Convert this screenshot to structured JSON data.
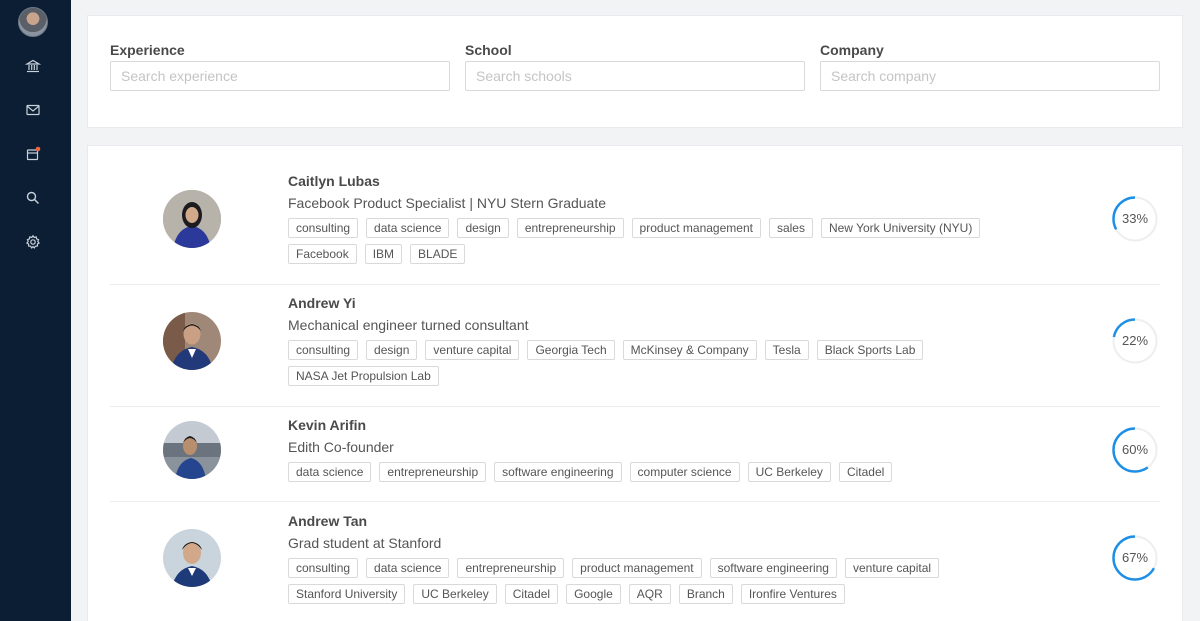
{
  "colors": {
    "sidebar": "#0b1e33",
    "accent": "#1f8fe6",
    "notification_dot": "#f0663f"
  },
  "sidebar": {
    "items": [
      {
        "icon": "bank-icon"
      },
      {
        "icon": "mail-icon"
      },
      {
        "icon": "calendar-icon"
      },
      {
        "icon": "search-icon"
      },
      {
        "icon": "gear-icon"
      }
    ]
  },
  "search": {
    "experience": {
      "label": "Experience",
      "placeholder": "Search experience"
    },
    "school": {
      "label": "School",
      "placeholder": "Search schools"
    },
    "company": {
      "label": "Company",
      "placeholder": "Search company"
    }
  },
  "profiles": [
    {
      "name": "Caitlyn Lubas",
      "headline": "Facebook Product Specialist | NYU Stern Graduate",
      "tags": [
        "consulting",
        "data science",
        "design",
        "entrepreneurship",
        "product management",
        "sales",
        "New York University (NYU)",
        "Facebook",
        "IBM",
        "BLADE"
      ],
      "match_label": "33%",
      "match": 0.33
    },
    {
      "name": "Andrew Yi",
      "headline": "Mechanical engineer turned consultant",
      "tags": [
        "consulting",
        "design",
        "venture capital",
        "Georgia Tech",
        "McKinsey & Company",
        "Tesla",
        "Black Sports Lab",
        "NASA Jet Propulsion Lab"
      ],
      "match_label": "22%",
      "match": 0.22
    },
    {
      "name": "Kevin Arifin",
      "headline": "Edith Co-founder",
      "tags": [
        "data science",
        "entrepreneurship",
        "software engineering",
        "computer science",
        "UC Berkeley",
        "Citadel"
      ],
      "match_label": "60%",
      "match": 0.6
    },
    {
      "name": "Andrew Tan",
      "headline": "Grad student at Stanford",
      "tags": [
        "consulting",
        "data science",
        "entrepreneurship",
        "product management",
        "software engineering",
        "venture capital",
        "Stanford University",
        "UC Berkeley",
        "Citadel",
        "Google",
        "AQR",
        "Branch",
        "Ironfire Ventures"
      ],
      "match_label": "67%",
      "match": 0.67
    }
  ]
}
